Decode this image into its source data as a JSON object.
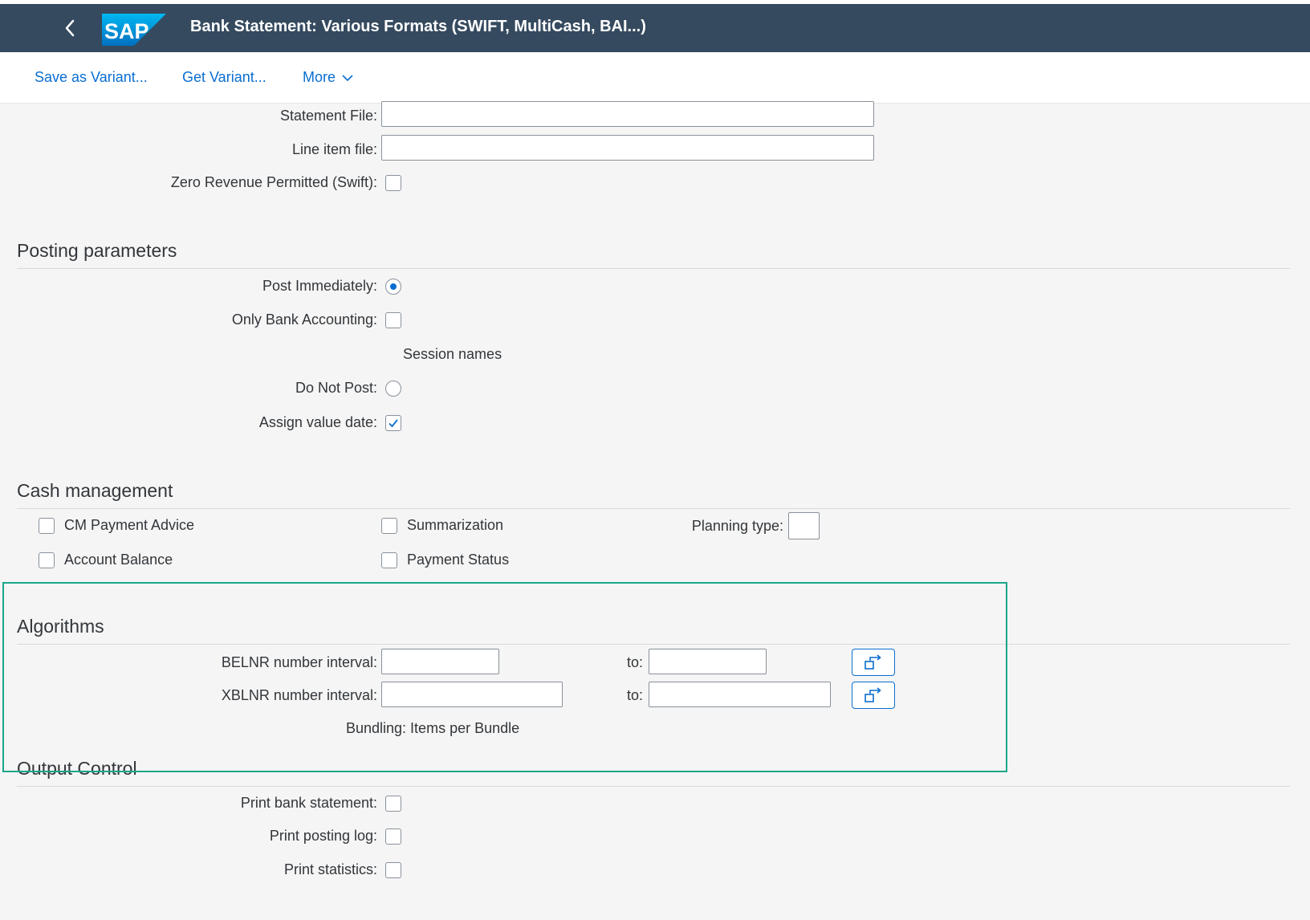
{
  "header": {
    "app_title": "Bank Statement: Various Formats (SWIFT, MultiCash, BAI...)",
    "logo_text": "SAP"
  },
  "toolbar": {
    "save_variant": "Save as Variant...",
    "get_variant": "Get Variant...",
    "more": "More"
  },
  "file_section": {
    "statement_file_label": "Statement File:",
    "statement_file_value": "",
    "line_item_file_label": "Line item file:",
    "line_item_file_value": "",
    "zero_revenue_label": "Zero Revenue Permitted (Swift):"
  },
  "posting": {
    "title": "Posting parameters",
    "post_immediately_label": "Post Immediately:",
    "only_bank_accounting_label": "Only Bank Accounting:",
    "session_names_label": "Session names",
    "do_not_post_label": "Do Not Post:",
    "assign_value_date_label": "Assign value date:"
  },
  "cash_management": {
    "title": "Cash management",
    "cm_payment_advice": "CM Payment Advice",
    "account_balance": "Account Balance",
    "summarization": "Summarization",
    "payment_status": "Payment Status",
    "planning_type_label": "Planning type:",
    "planning_type_value": ""
  },
  "algorithms": {
    "title": "Algorithms",
    "belnr_label": "BELNR number interval:",
    "belnr_from": "",
    "belnr_to": "",
    "xblnr_label": "XBLNR number interval:",
    "xblnr_from": "",
    "xblnr_to": "",
    "to_label": "to:",
    "bundling_label": "Bundling: Items per Bundle"
  },
  "output_control": {
    "title": "Output Control",
    "print_bank_statement_label": "Print bank statement:",
    "print_posting_log_label": "Print posting log:",
    "print_statistics_label": "Print statistics:"
  },
  "state": {
    "zero_revenue_checked": false,
    "post_immediately_selected": true,
    "only_bank_accounting_checked": false,
    "do_not_post_selected": false,
    "assign_value_date_checked": true,
    "cm_payment_advice_checked": false,
    "account_balance_checked": false,
    "summarization_checked": false,
    "payment_status_checked": false,
    "print_bank_statement_checked": false,
    "print_posting_log_checked": false,
    "print_statistics_checked": false
  },
  "colors": {
    "shell_bar": "#354a5f",
    "link": "#0a6ed1",
    "highlight_border": "#1aa68a",
    "page_background": "#f5f5f5"
  },
  "icons": {
    "back": "chevron-left-icon",
    "more": "chevron-down-icon",
    "multiple_selection": "multiple-selection-icon",
    "checkmark": "checkmark-icon"
  }
}
